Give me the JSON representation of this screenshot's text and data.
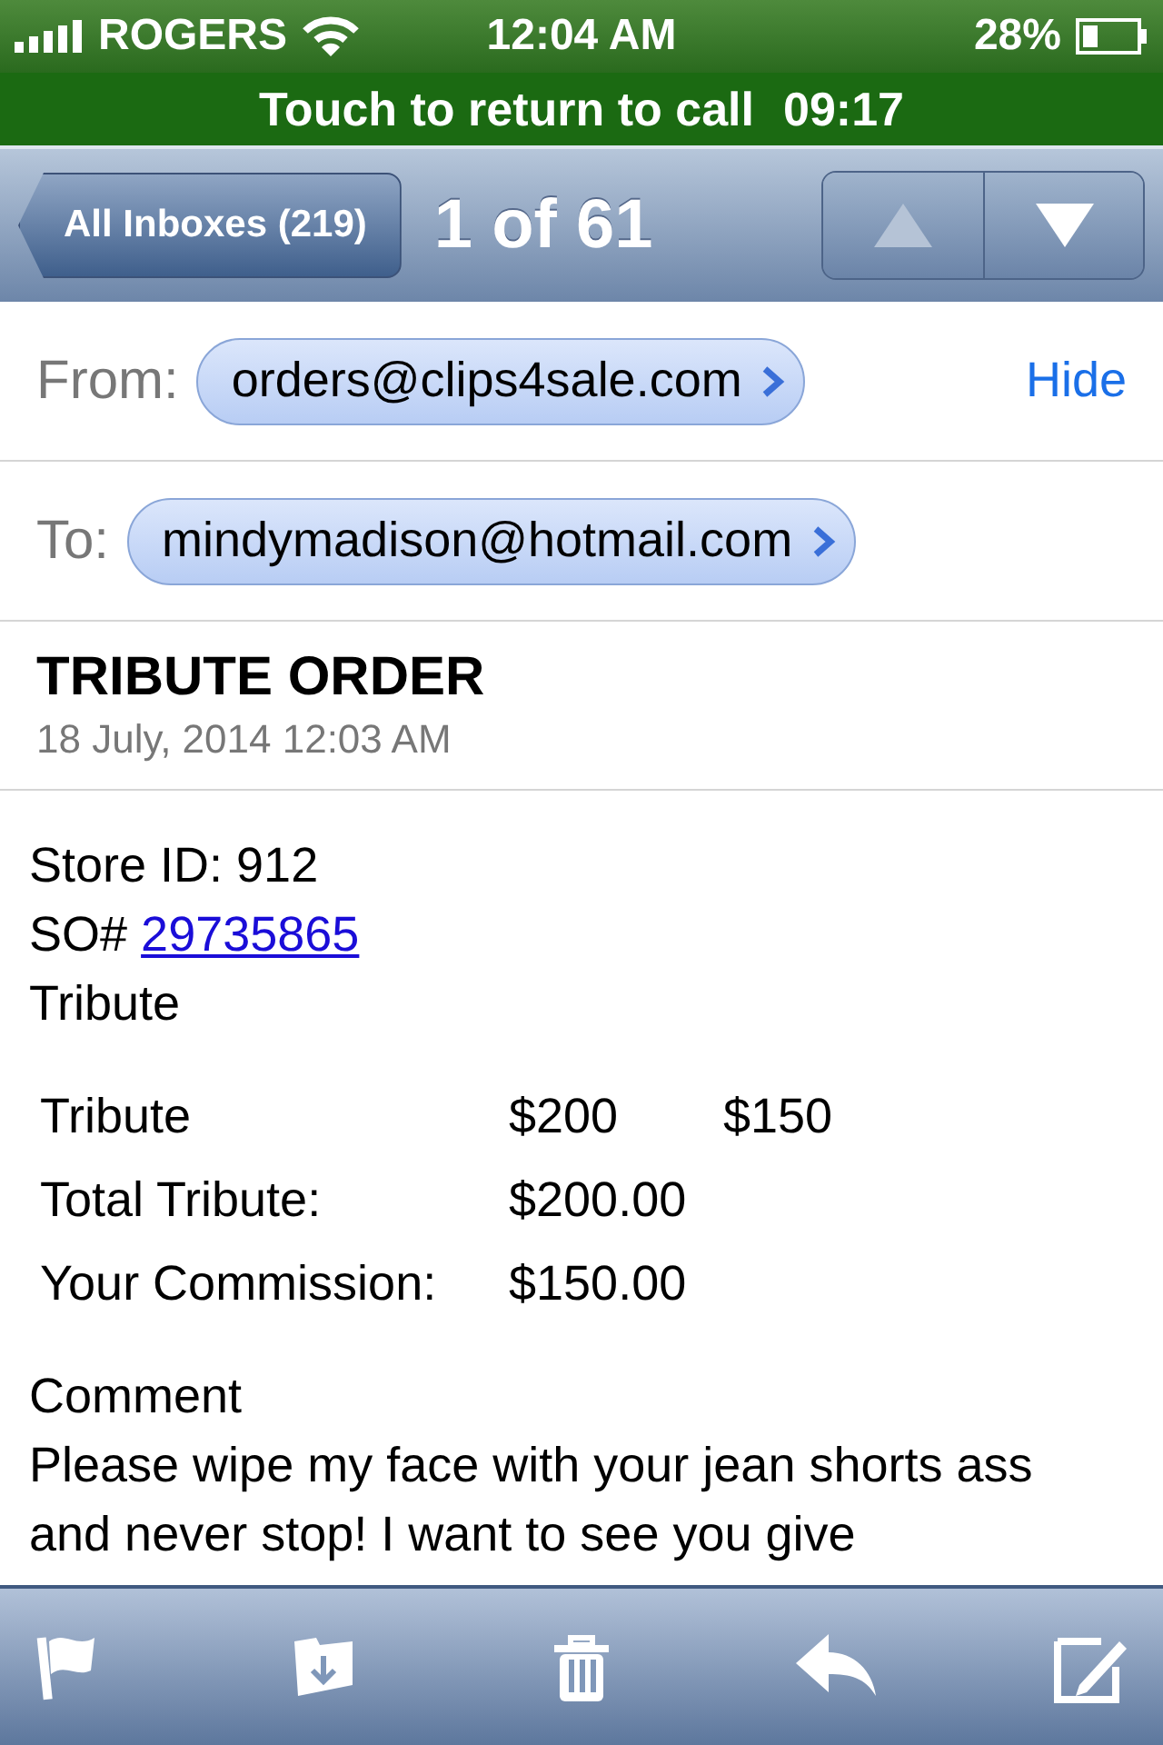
{
  "status_bar": {
    "carrier": "ROGERS",
    "time": "12:04 AM",
    "battery": "28%"
  },
  "call_banner": {
    "label": "Touch to return to call",
    "timer": "09:17"
  },
  "nav_bar": {
    "back": "All Inboxes (219)",
    "position": "1 of 61",
    "arrows": [
      {
        "kind": "up",
        "disabled": true
      },
      {
        "kind": "down",
        "disabled": false
      }
    ]
  },
  "header": {
    "from_label": "From:",
    "from": "orders@clips4sale.com",
    "hide": "Hide",
    "to_label": "To:",
    "to": "mindymadison@hotmail.com",
    "subject": "TRIBUTE ORDER",
    "date": "18 July, 2014 12:03 AM"
  },
  "body": {
    "store": "Store ID: 912",
    "so_label": "SO#",
    "so_link": "29735865",
    "kind_line": "Tribute",
    "table_rows": [
      [
        "Tribute",
        "$200",
        "$150"
      ],
      [
        "Total Tribute:",
        "$200.00"
      ],
      [
        "Your Commission:",
        "$150.00"
      ]
    ],
    "comment_label": "Comment",
    "comment": "Please wipe my face with your jean shorts ass and never stop! I want to see you give"
  },
  "toolbar": [
    {
      "kind": "flag"
    },
    {
      "kind": "move"
    },
    {
      "kind": "trash"
    },
    {
      "kind": "reply"
    },
    {
      "kind": "compose"
    }
  ]
}
